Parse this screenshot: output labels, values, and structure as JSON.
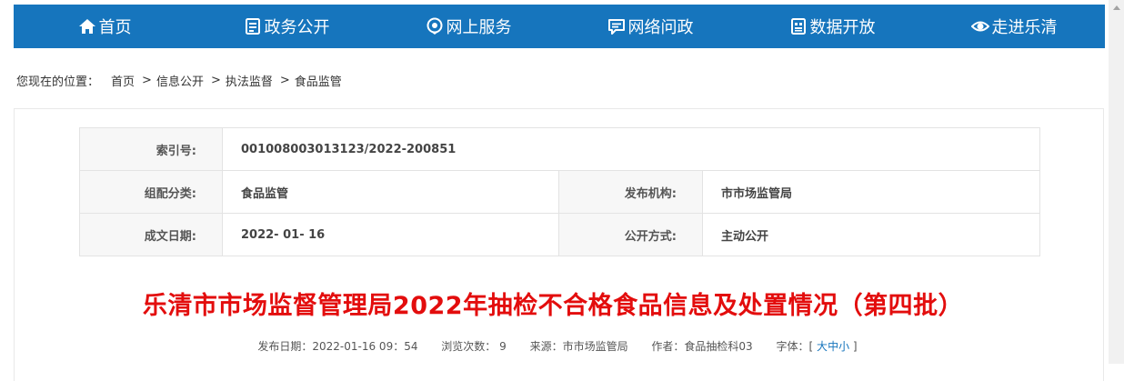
{
  "nav": {
    "items": [
      {
        "label": "首页",
        "icon": "home-icon"
      },
      {
        "label": "政务公开",
        "icon": "document-icon"
      },
      {
        "label": "网上服务",
        "icon": "service-icon"
      },
      {
        "label": "网络问政",
        "icon": "chat-icon"
      },
      {
        "label": "数据开放",
        "icon": "data-icon"
      },
      {
        "label": "走进乐清",
        "icon": "eye-icon"
      }
    ],
    "bg_color": "#1675bd"
  },
  "breadcrumb": {
    "prefix": "您现在的位置：",
    "items": [
      "首页",
      "信息公开",
      "执法监督",
      "食品监管"
    ],
    "separator": ">"
  },
  "meta": {
    "index_label": "索引号:",
    "index_value": "001008003013123/2022-200851",
    "category_label": "组配分类:",
    "category_value": "食品监管",
    "publisher_label": "发布机构:",
    "publisher_value": "市市场监管局",
    "date_label": "成文日期:",
    "date_value": "2022- 01- 16",
    "disclosure_label": "公开方式:",
    "disclosure_value": "主动公开"
  },
  "article": {
    "title": "乐清市市场监督管理局2022年抽检不合格食品信息及处置情况（第四批）",
    "title_color": "#e30d0d",
    "publish_date": "发布日期：2022-01-16 09：54",
    "views": "浏览次数：  9",
    "source": "来源：市市场监管局",
    "author": "作者：食品抽检科03",
    "font_label": "字体：[",
    "font_large": "大",
    "font_medium": "中",
    "font_small": "小",
    "font_close": "]"
  }
}
